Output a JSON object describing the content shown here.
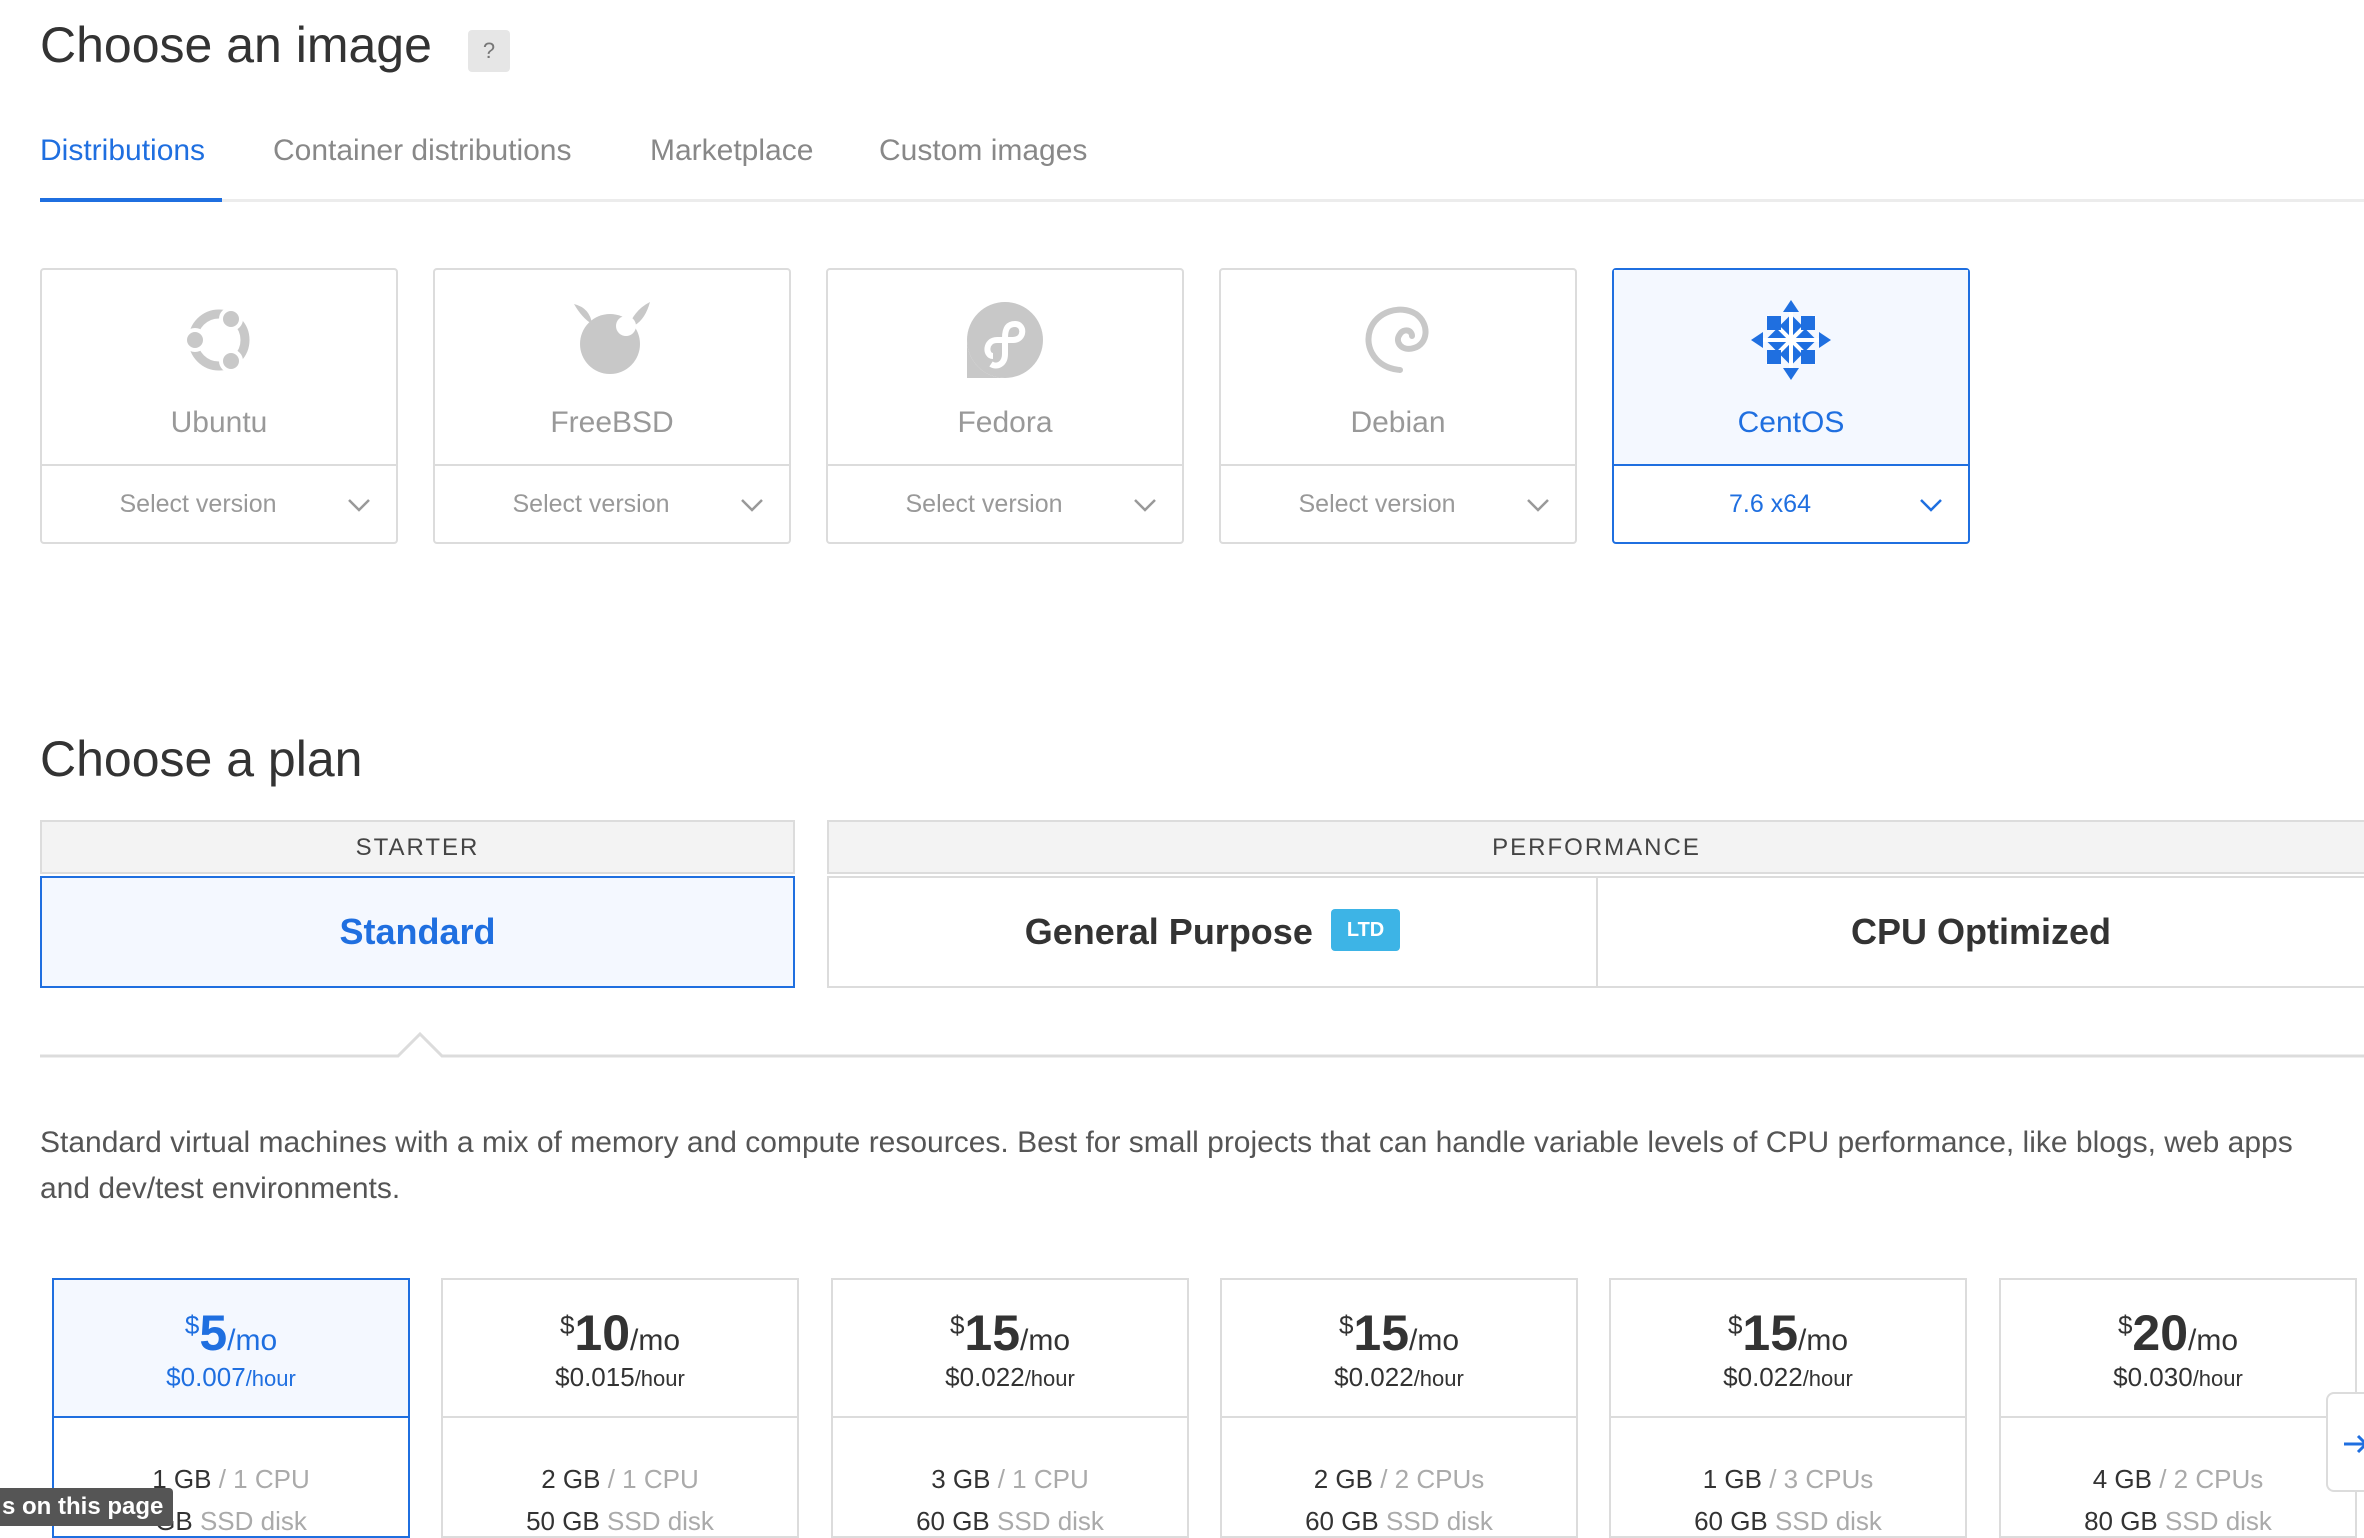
{
  "image_section": {
    "title": "Choose an image",
    "help": "?",
    "tabs": [
      {
        "label": "Distributions",
        "active": true
      },
      {
        "label": "Container distributions",
        "active": false
      },
      {
        "label": "Marketplace",
        "active": false
      },
      {
        "label": "Custom images",
        "active": false
      }
    ],
    "distros": [
      {
        "name": "Ubuntu",
        "version": "Select version",
        "icon": "ubuntu-icon",
        "selected": false
      },
      {
        "name": "FreeBSD",
        "version": "Select version",
        "icon": "freebsd-icon",
        "selected": false
      },
      {
        "name": "Fedora",
        "version": "Select version",
        "icon": "fedora-icon",
        "selected": false
      },
      {
        "name": "Debian",
        "version": "Select version",
        "icon": "debian-icon",
        "selected": false
      },
      {
        "name": "CentOS",
        "version": "7.6 x64",
        "icon": "centos-icon",
        "selected": true
      }
    ]
  },
  "plan_section": {
    "title": "Choose a plan",
    "starter_label": "STARTER",
    "performance_label": "PERFORMANCE",
    "plan_types": [
      {
        "label": "Standard",
        "selected": true
      },
      {
        "label": "General Purpose",
        "badge": "LTD",
        "selected": false
      },
      {
        "label": "CPU Optimized",
        "selected": false
      }
    ],
    "description": "Standard virtual machines with a mix of memory and compute resources. Best for small projects that can handle variable levels of CPU performance, like blogs, web apps and dev/test environments.",
    "prices": [
      {
        "currency": "$",
        "amount": "5",
        "per": "/mo",
        "hourly": "$0.007",
        "hour_unit": "/hour",
        "mem": "1 GB",
        "cpu": "1 CPU",
        "disk": "GB",
        "disk_type": "SSD disk",
        "selected": true
      },
      {
        "currency": "$",
        "amount": "10",
        "per": "/mo",
        "hourly": "$0.015",
        "hour_unit": "/hour",
        "mem": "2 GB",
        "cpu": "1 CPU",
        "disk": "50 GB",
        "disk_type": "SSD disk",
        "selected": false
      },
      {
        "currency": "$",
        "amount": "15",
        "per": "/mo",
        "hourly": "$0.022",
        "hour_unit": "/hour",
        "mem": "3 GB",
        "cpu": "1 CPU",
        "disk": "60 GB",
        "disk_type": "SSD disk",
        "selected": false
      },
      {
        "currency": "$",
        "amount": "15",
        "per": "/mo",
        "hourly": "$0.022",
        "hour_unit": "/hour",
        "mem": "2 GB",
        "cpu": "2 CPUs",
        "disk": "60 GB",
        "disk_type": "SSD disk",
        "selected": false
      },
      {
        "currency": "$",
        "amount": "15",
        "per": "/mo",
        "hourly": "$0.022",
        "hour_unit": "/hour",
        "mem": "1 GB",
        "cpu": "3 CPUs",
        "disk": "60 GB",
        "disk_type": "SSD disk",
        "selected": false
      },
      {
        "currency": "$",
        "amount": "20",
        "per": "/mo",
        "hourly": "$0.030",
        "hour_unit": "/hour",
        "mem": "4 GB",
        "cpu": "2 CPUs",
        "disk": "80 GB",
        "disk_type": "SSD disk",
        "selected": false
      }
    ]
  },
  "tooltip": "s on this page",
  "colors": {
    "accent": "#1f6fe0",
    "ltd_badge": "#3db4e6",
    "muted": "#999999",
    "border": "#dcdcdc"
  }
}
